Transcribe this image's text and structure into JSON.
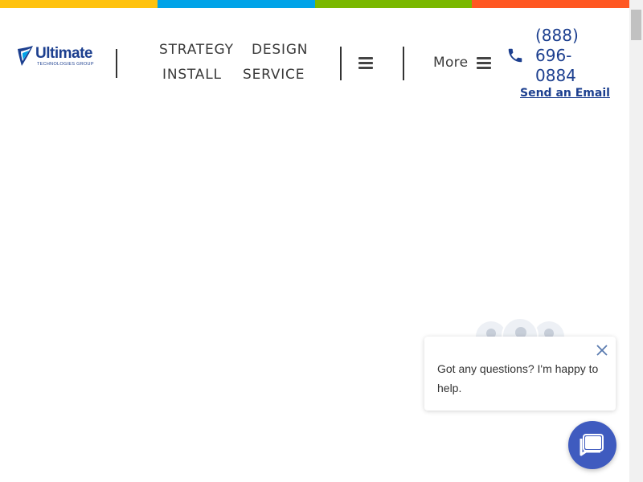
{
  "colors": {
    "brand_blue": "#1c3f8f",
    "bar": [
      "#ffc20e",
      "#00a3e8",
      "#7ab800",
      "#ff5722"
    ],
    "chat_button": "#3f5bbf"
  },
  "logo": {
    "name": "Ultimate",
    "tagline": "TECHNOLOGIES GROUP",
    "icon": "shield-swoosh-icon"
  },
  "nav": {
    "items": [
      {
        "label": "STRATEGY"
      },
      {
        "label": "DESIGN"
      },
      {
        "label": "INSTALL"
      },
      {
        "label": "SERVICE"
      }
    ],
    "menu_icon": "hamburger-icon",
    "more_label": "More",
    "more_icon": "hamburger-icon"
  },
  "contact": {
    "phone_icon": "phone-icon",
    "phone_lines": [
      "(888)",
      "696-",
      "0884"
    ],
    "email_label": "Send an Email"
  },
  "chat": {
    "message": "Got any questions? I'm happy to help.",
    "close_icon": "close-icon",
    "launcher_icon": "chat-bubble-icon"
  }
}
